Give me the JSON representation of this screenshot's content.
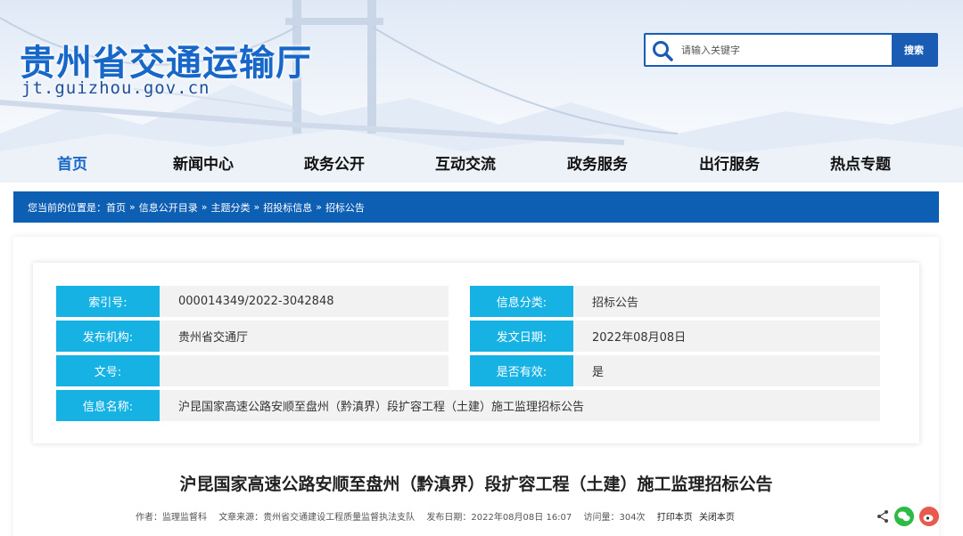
{
  "header": {
    "site_title": "贵州省交通运输厅",
    "site_domain": "jt.guizhou.gov.cn"
  },
  "search": {
    "placeholder": "请输入关键字",
    "button_label": "搜索"
  },
  "nav": {
    "items": [
      {
        "label": "首页"
      },
      {
        "label": "新闻中心"
      },
      {
        "label": "政务公开"
      },
      {
        "label": "互动交流"
      },
      {
        "label": "政务服务"
      },
      {
        "label": "出行服务"
      },
      {
        "label": "热点专题"
      }
    ]
  },
  "breadcrumb": {
    "prefix": "您当前的位置是：",
    "items": [
      "首页",
      "信息公开目录",
      "主题分类",
      "招投标信息",
      "招标公告"
    ],
    "separator": "»"
  },
  "info": {
    "index_label": "索引号:",
    "index_value": "000014349/2022-3042848",
    "category_label": "信息分类:",
    "category_value": "招标公告",
    "publisher_label": "发布机构:",
    "publisher_value": "贵州省交通厅",
    "date_label": "发文日期:",
    "date_value": "2022年08月08日",
    "docno_label": "文号:",
    "docno_value": "",
    "valid_label": "是否有效:",
    "valid_value": "是",
    "name_label": "信息名称:",
    "name_value": "沪昆国家高速公路安顺至盘州（黔滇界）段扩容工程（土建）施工监理招标公告"
  },
  "article": {
    "title": "沪昆国家高速公路安顺至盘州（黔滇界）段扩容工程（土建）施工监理招标公告",
    "author": "作者：监理监督科",
    "source": "文章来源：贵州省交通建设工程质量监督执法支队",
    "publish_date": "发布日期：2022年08月08日 16:07",
    "views": "访问量：304次",
    "print_label": "打印本页",
    "close_label": "关闭本页"
  },
  "colors": {
    "brand_blue": "#1667c7",
    "breadcrumb_bg": "#0d5fb4",
    "label_cyan": "#17b2e4",
    "wechat_green": "#2dbb45",
    "weibo_red": "#e85a4f"
  }
}
